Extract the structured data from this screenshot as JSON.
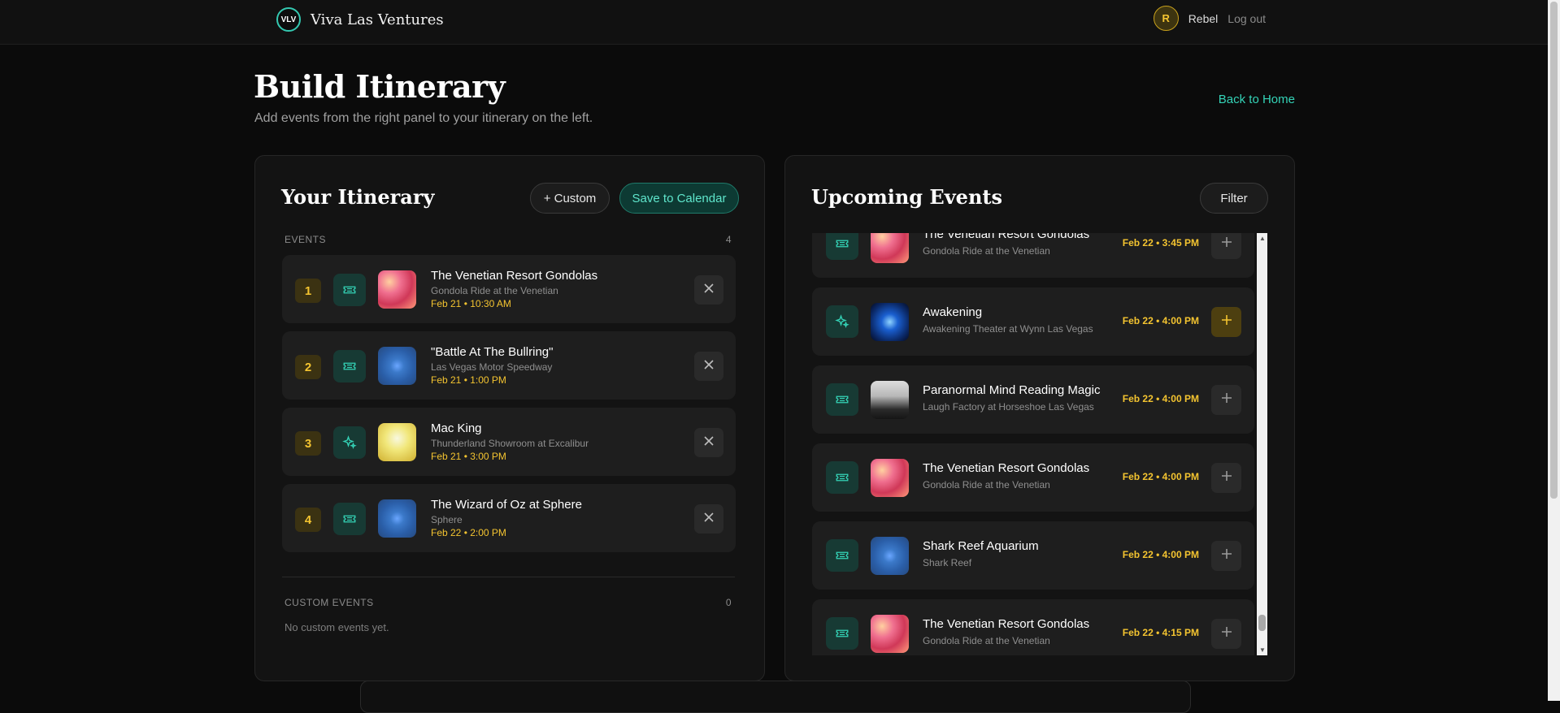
{
  "header": {
    "logo_text": "VLV",
    "brand": "Viva Las Ventures",
    "avatar_initial": "R",
    "username": "Rebel",
    "logout_label": "Log out"
  },
  "page": {
    "title": "Build Itinerary",
    "subtitle": "Add events from the right panel to your itinerary on the left.",
    "back_label": "Back to Home"
  },
  "itinerary": {
    "title": "Your Itinerary",
    "custom_button": "+ Custom",
    "save_button": "Save to Calendar",
    "events_label": "EVENTS",
    "events_count": "4",
    "items": [
      {
        "num": "1",
        "icon": "ticket-icon",
        "title": "The Venetian Resort Gondolas",
        "venue": "Gondola Ride at the Venetian",
        "date": "Feb 21 • 10:30 AM"
      },
      {
        "num": "2",
        "icon": "ticket-icon",
        "title": "\"Battle At The Bullring\"",
        "venue": "Las Vegas Motor Speedway",
        "date": "Feb 21 • 1:00 PM"
      },
      {
        "num": "3",
        "icon": "sparkle-icon",
        "title": "Mac King",
        "venue": "Thunderland Showroom at Excalibur",
        "date": "Feb 21 • 3:00 PM"
      },
      {
        "num": "4",
        "icon": "ticket-icon",
        "title": "The Wizard of Oz at Sphere",
        "venue": "Sphere",
        "date": "Feb 22 • 2:00 PM"
      }
    ],
    "custom_label": "CUSTOM EVENTS",
    "custom_count": "0",
    "custom_empty": "No custom events yet."
  },
  "upcoming": {
    "title": "Upcoming Events",
    "filter_button": "Filter",
    "items": [
      {
        "icon": "ticket-icon",
        "title": "The Venetian Resort Gondolas",
        "venue": "Gondola Ride at the Venetian",
        "date": "Feb 22 • 3:45 PM"
      },
      {
        "icon": "sparkle-icon",
        "title": "Awakening",
        "venue": "Awakening Theater at Wynn Las Vegas",
        "date": "Feb 22 • 4:00 PM"
      },
      {
        "icon": "ticket-icon",
        "title": "Paranormal Mind Reading Magic",
        "venue": "Laugh Factory at Horseshoe Las Vegas",
        "date": "Feb 22 • 4:00 PM"
      },
      {
        "icon": "ticket-icon",
        "title": "The Venetian Resort Gondolas",
        "venue": "Gondola Ride at the Venetian",
        "date": "Feb 22 • 4:00 PM"
      },
      {
        "icon": "ticket-icon",
        "title": "Shark Reef Aquarium",
        "venue": "Shark Reef",
        "date": "Feb 22 • 4:00 PM"
      },
      {
        "icon": "ticket-icon",
        "title": "The Venetian Resort Gondolas",
        "venue": "Gondola Ride at the Venetian",
        "date": "Feb 22 • 4:15 PM"
      }
    ]
  },
  "colors": {
    "accent_teal": "#34d3b7",
    "accent_gold": "#f4c430",
    "background": "#0b0b0b"
  }
}
